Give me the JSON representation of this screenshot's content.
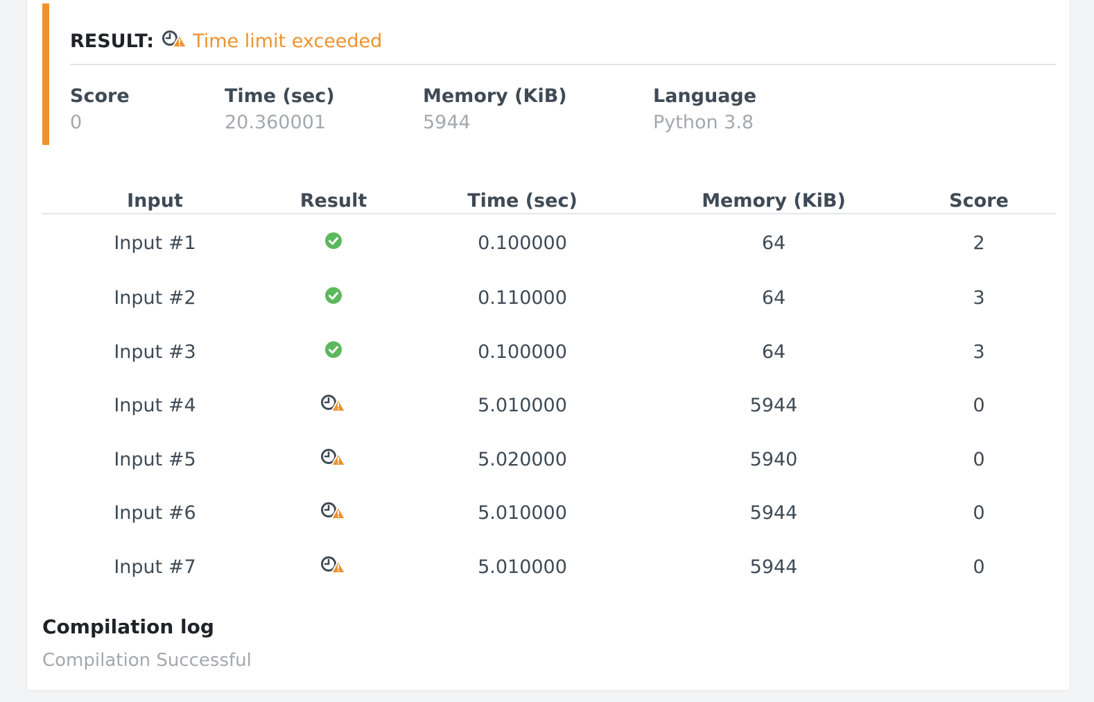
{
  "result": {
    "label": "RESULT:",
    "status_text": "Time limit exceeded",
    "status_icon": "clock-warning-icon",
    "status_color": "#f0922d"
  },
  "stats": [
    {
      "label": "Score",
      "value": "0"
    },
    {
      "label": "Time (sec)",
      "value": "20.360001"
    },
    {
      "label": "Memory (KiB)",
      "value": "5944"
    },
    {
      "label": "Language",
      "value": "Python 3.8"
    }
  ],
  "table": {
    "headers": [
      "Input",
      "Result",
      "Time (sec)",
      "Memory (KiB)",
      "Score"
    ],
    "rows": [
      {
        "input": "Input #1",
        "result": "accepted",
        "time": "0.100000",
        "memory": "64",
        "score": "2"
      },
      {
        "input": "Input #2",
        "result": "accepted",
        "time": "0.110000",
        "memory": "64",
        "score": "3"
      },
      {
        "input": "Input #3",
        "result": "accepted",
        "time": "0.100000",
        "memory": "64",
        "score": "3"
      },
      {
        "input": "Input #4",
        "result": "time_limit",
        "time": "5.010000",
        "memory": "5944",
        "score": "0"
      },
      {
        "input": "Input #5",
        "result": "time_limit",
        "time": "5.020000",
        "memory": "5940",
        "score": "0"
      },
      {
        "input": "Input #6",
        "result": "time_limit",
        "time": "5.010000",
        "memory": "5944",
        "score": "0"
      },
      {
        "input": "Input #7",
        "result": "time_limit",
        "time": "5.010000",
        "memory": "5944",
        "score": "0"
      }
    ]
  },
  "icons": {
    "accepted": "check-circle-icon",
    "time_limit": "clock-warning-icon"
  },
  "colors": {
    "accent": "#f0922d",
    "success": "#5cb85c",
    "muted": "#a3a8ae"
  },
  "compilation": {
    "title": "Compilation log",
    "text": "Compilation Successful"
  }
}
